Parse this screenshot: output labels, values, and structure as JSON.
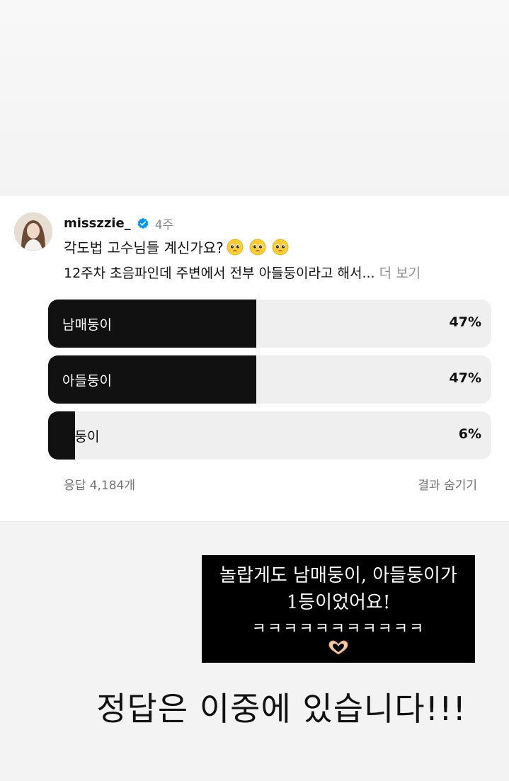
{
  "post": {
    "username": "misszzie_",
    "time": "4주",
    "caption_line1": "각도법 고수님들 계신가요?",
    "caption_line2": "12주차 초음파인데 주변에서 전부 아들둥이라고 해서...",
    "more_label": "더 보기",
    "icons": {
      "verified": "verified-badge-icon",
      "emoji": "pleading-face-emoji"
    }
  },
  "poll": {
    "options": [
      {
        "label": "남매둥이",
        "percent_label": "47%",
        "percent": 47
      },
      {
        "label": "아들둥이",
        "percent_label": "47%",
        "percent": 47
      },
      {
        "label": "딸둥이",
        "percent_label": "6%",
        "percent": 6
      }
    ],
    "responses": "응답 4,184개",
    "hide_results": "결과 숨기기"
  },
  "story": {
    "caption_line1": "놀랍게도 남매둥이, 아들둥이가",
    "caption_line2": "1등이었어요!",
    "caption_line3": "ㅋㅋㅋㅋㅋㅋㅋㅋㅋㅋㅋ",
    "big_caption": "정답은 이중에 있습니다!!!",
    "icons": {
      "heart_hands": "heart-hands-emoji"
    }
  }
}
